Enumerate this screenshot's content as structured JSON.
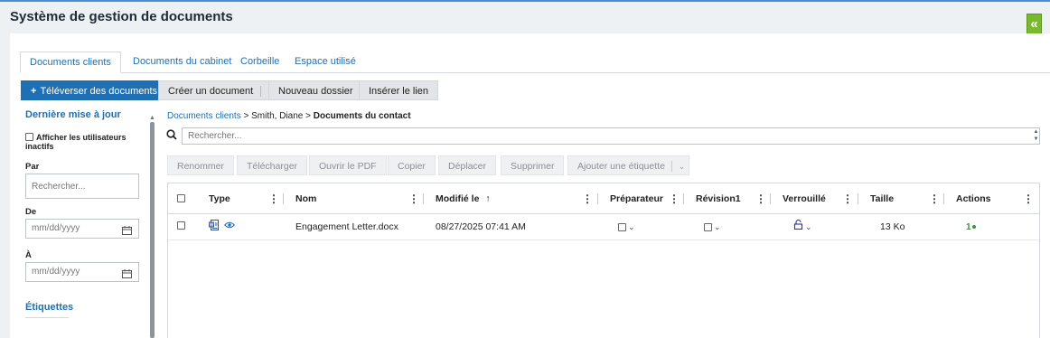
{
  "app": {
    "title": "Système de gestion de documents",
    "collapse_glyph": "«"
  },
  "tabs": [
    {
      "label": "Documents clients",
      "active": true
    },
    {
      "label": "Documents du cabinet",
      "active": false
    },
    {
      "label": "Corbeille",
      "active": false
    },
    {
      "label": "Espace utilisé",
      "active": false
    }
  ],
  "toolbar": {
    "upload_label": "Téléverser des documents",
    "create_label": "Créer un document",
    "new_folder_label": "Nouveau dossier",
    "insert_link_label": "Insérer le lien"
  },
  "sidebar": {
    "last_update_heading": "Dernière mise à jour",
    "show_inactive_label": "Afficher les utilisateurs inactifs",
    "by_label": "Par",
    "search_placeholder": "Rechercher...",
    "from_label": "De",
    "to_label": "À",
    "date_placeholder": "mm/dd/yyyy",
    "tags_heading": "Étiquettes"
  },
  "breadcrumb": {
    "root": "Documents clients",
    "separator": " > ",
    "contact": "Smith, Diane",
    "current": "Documents du contact"
  },
  "search": {
    "placeholder": "Rechercher..."
  },
  "actions": {
    "rename": "Renommer",
    "download": "Télécharger",
    "open_pdf": "Ouvrir le PDF",
    "copy": "Copier",
    "move": "Déplacer",
    "delete": "Supprimer",
    "add_tag": "Ajouter une étiquette"
  },
  "table": {
    "columns": {
      "type": "Type",
      "name": "Nom",
      "modified": "Modifié le",
      "preparer": "Préparateur",
      "revision": "Révision1",
      "locked": "Verrouillé",
      "size": "Taille",
      "actions": "Actions"
    },
    "sort_indicator": "↑",
    "rows": [
      {
        "name": "Engagement Letter.docx",
        "modified": "08/27/2025 07:41 AM",
        "size": "13 Ko",
        "actions_count": "1"
      }
    ]
  },
  "colors": {
    "accent": "#1f6fb5",
    "collapse_button": "#7ab82e",
    "action_badge": "#2e9b3c"
  },
  "icons": {
    "word_doc": "word-doc-icon",
    "preview": "eye-icon",
    "lock": "unlocked-icon",
    "calendar": "calendar-icon",
    "search": "search-icon"
  }
}
